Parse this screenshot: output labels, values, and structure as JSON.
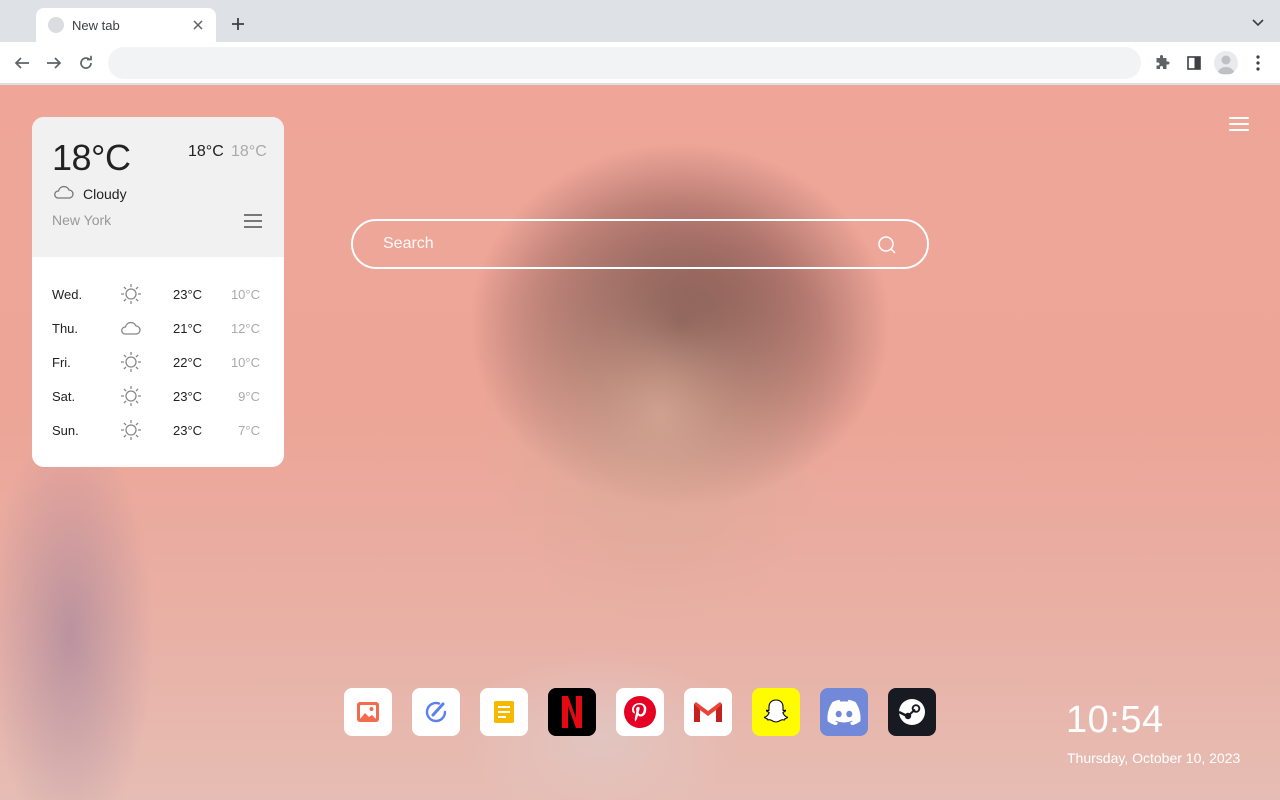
{
  "browser": {
    "tab": {
      "title": "New tab",
      "icon": "globe-icon"
    },
    "omnibox": {
      "value": "",
      "placeholder": ""
    }
  },
  "weather": {
    "current_temp": "18°C",
    "high": "18°C",
    "low": "18°C",
    "condition": "Cloudy",
    "condition_icon": "cloud-icon",
    "city": "New York",
    "forecast": [
      {
        "day": "Wed.",
        "icon": "sun-icon",
        "high": "23°C",
        "low": "10°C"
      },
      {
        "day": "Thu.",
        "icon": "cloud-icon",
        "high": "21°C",
        "low": "12°C"
      },
      {
        "day": "Fri.",
        "icon": "sun-icon",
        "high": "22°C",
        "low": "10°C"
      },
      {
        "day": "Sat.",
        "icon": "sun-icon",
        "high": "23°C",
        "low": "9°C"
      },
      {
        "day": "Sun.",
        "icon": "sun-icon",
        "high": "23°C",
        "low": "7°C"
      }
    ]
  },
  "search": {
    "placeholder": "Search"
  },
  "dock": [
    {
      "name": "photos",
      "icon": "image-icon",
      "bg": "#ffffff"
    },
    {
      "name": "tasks",
      "icon": "check-pen-icon",
      "bg": "#ffffff"
    },
    {
      "name": "notes",
      "icon": "note-icon",
      "bg": "#ffffff"
    },
    {
      "name": "netflix",
      "icon": "netflix-icon",
      "bg": "#000000"
    },
    {
      "name": "pinterest",
      "icon": "pinterest-icon",
      "bg": "#ffffff"
    },
    {
      "name": "gmail",
      "icon": "gmail-icon",
      "bg": "#ffffff"
    },
    {
      "name": "snapchat",
      "icon": "snapchat-icon",
      "bg": "#fffc00"
    },
    {
      "name": "discord",
      "icon": "discord-icon",
      "bg": "#7289da"
    },
    {
      "name": "steam",
      "icon": "steam-icon",
      "bg": "#171a21"
    }
  ],
  "clock": {
    "time": "10:54",
    "date": "Thursday, October 10, 2023"
  }
}
